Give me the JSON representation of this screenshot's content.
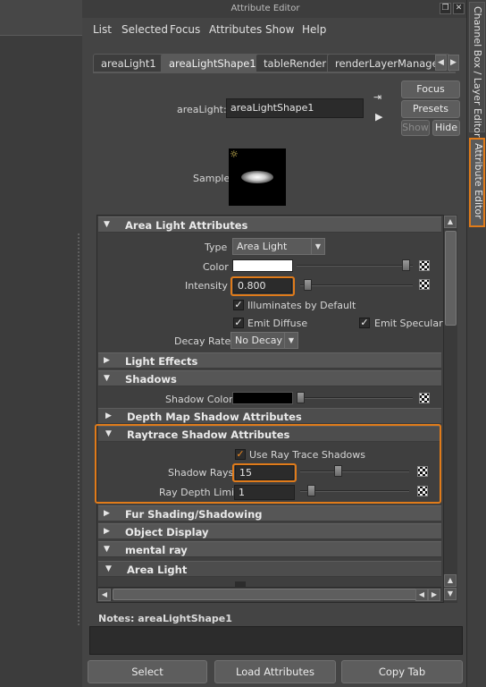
{
  "window": {
    "title": "Attribute Editor"
  },
  "menu": [
    "List",
    "Selected",
    "Focus",
    "Attributes",
    "Show",
    "Help"
  ],
  "tabs": [
    "areaLight1",
    "areaLightShape1",
    "tableRender",
    "renderLayerManager"
  ],
  "node": {
    "label": "areaLight:",
    "value": "areaLightShape1",
    "buttons": {
      "focus": "Focus",
      "presets": "Presets",
      "show": "Show",
      "hide": "Hide"
    }
  },
  "sample": {
    "label": "Sample"
  },
  "area_light_attributes": {
    "title": "Area Light Attributes",
    "type_label": "Type",
    "type_value": "Area Light",
    "color_label": "Color",
    "color_value": "#ffffff",
    "intensity_label": "Intensity",
    "intensity_value": "0.800",
    "illuminates_default": "Illuminates by Default",
    "emit_diffuse": "Emit Diffuse",
    "emit_specular": "Emit Specular",
    "decay_label": "Decay Rate",
    "decay_value": "No Decay"
  },
  "sections": {
    "light_effects": "Light Effects",
    "shadows": "Shadows",
    "shadow_color_label": "Shadow Color",
    "shadow_color_value": "#000000",
    "depth_map": "Depth Map Shadow Attributes",
    "raytrace": "Raytrace Shadow Attributes",
    "use_ray_trace": "Use Ray Trace Shadows",
    "shadow_rays_label": "Shadow Rays",
    "shadow_rays_value": "15",
    "ray_depth_label": "Ray Depth Limit",
    "ray_depth_value": "1",
    "fur": "Fur Shading/Shadowing",
    "object_display": "Object Display",
    "mental_ray": "mental ray",
    "area_light": "Area Light"
  },
  "notes": {
    "label": "Notes:",
    "node": "areaLightShape1"
  },
  "bottom": {
    "select": "Select",
    "load": "Load Attributes",
    "copy": "Copy Tab"
  },
  "side_tabs": {
    "channel_box": "Channel Box / Layer Editor",
    "attribute_editor": "Attribute Editor"
  },
  "colors": {
    "highlight": "#e07b1a",
    "panel": "#444444",
    "field": "#2b2b2b"
  },
  "icons": [
    "area-light-icon",
    "select-node-icon",
    "load-node-icon",
    "map-button-icon",
    "checkmark-icon",
    "triangle-expanded-icon",
    "triangle-collapsed-icon"
  ]
}
